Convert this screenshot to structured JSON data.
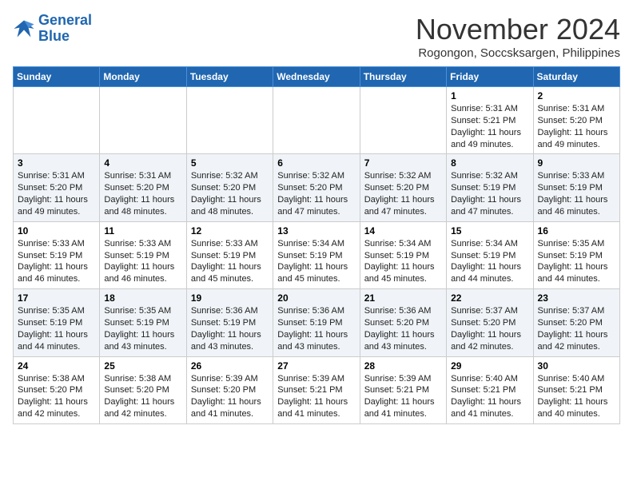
{
  "header": {
    "logo_line1": "General",
    "logo_line2": "Blue",
    "month": "November 2024",
    "location": "Rogongon, Soccsksargen, Philippines"
  },
  "weekdays": [
    "Sunday",
    "Monday",
    "Tuesday",
    "Wednesday",
    "Thursday",
    "Friday",
    "Saturday"
  ],
  "weeks": [
    [
      {
        "day": "",
        "info": ""
      },
      {
        "day": "",
        "info": ""
      },
      {
        "day": "",
        "info": ""
      },
      {
        "day": "",
        "info": ""
      },
      {
        "day": "",
        "info": ""
      },
      {
        "day": "1",
        "info": "Sunrise: 5:31 AM\nSunset: 5:21 PM\nDaylight: 11 hours\nand 49 minutes."
      },
      {
        "day": "2",
        "info": "Sunrise: 5:31 AM\nSunset: 5:20 PM\nDaylight: 11 hours\nand 49 minutes."
      }
    ],
    [
      {
        "day": "3",
        "info": "Sunrise: 5:31 AM\nSunset: 5:20 PM\nDaylight: 11 hours\nand 49 minutes."
      },
      {
        "day": "4",
        "info": "Sunrise: 5:31 AM\nSunset: 5:20 PM\nDaylight: 11 hours\nand 48 minutes."
      },
      {
        "day": "5",
        "info": "Sunrise: 5:32 AM\nSunset: 5:20 PM\nDaylight: 11 hours\nand 48 minutes."
      },
      {
        "day": "6",
        "info": "Sunrise: 5:32 AM\nSunset: 5:20 PM\nDaylight: 11 hours\nand 47 minutes."
      },
      {
        "day": "7",
        "info": "Sunrise: 5:32 AM\nSunset: 5:20 PM\nDaylight: 11 hours\nand 47 minutes."
      },
      {
        "day": "8",
        "info": "Sunrise: 5:32 AM\nSunset: 5:19 PM\nDaylight: 11 hours\nand 47 minutes."
      },
      {
        "day": "9",
        "info": "Sunrise: 5:33 AM\nSunset: 5:19 PM\nDaylight: 11 hours\nand 46 minutes."
      }
    ],
    [
      {
        "day": "10",
        "info": "Sunrise: 5:33 AM\nSunset: 5:19 PM\nDaylight: 11 hours\nand 46 minutes."
      },
      {
        "day": "11",
        "info": "Sunrise: 5:33 AM\nSunset: 5:19 PM\nDaylight: 11 hours\nand 46 minutes."
      },
      {
        "day": "12",
        "info": "Sunrise: 5:33 AM\nSunset: 5:19 PM\nDaylight: 11 hours\nand 45 minutes."
      },
      {
        "day": "13",
        "info": "Sunrise: 5:34 AM\nSunset: 5:19 PM\nDaylight: 11 hours\nand 45 minutes."
      },
      {
        "day": "14",
        "info": "Sunrise: 5:34 AM\nSunset: 5:19 PM\nDaylight: 11 hours\nand 45 minutes."
      },
      {
        "day": "15",
        "info": "Sunrise: 5:34 AM\nSunset: 5:19 PM\nDaylight: 11 hours\nand 44 minutes."
      },
      {
        "day": "16",
        "info": "Sunrise: 5:35 AM\nSunset: 5:19 PM\nDaylight: 11 hours\nand 44 minutes."
      }
    ],
    [
      {
        "day": "17",
        "info": "Sunrise: 5:35 AM\nSunset: 5:19 PM\nDaylight: 11 hours\nand 44 minutes."
      },
      {
        "day": "18",
        "info": "Sunrise: 5:35 AM\nSunset: 5:19 PM\nDaylight: 11 hours\nand 43 minutes."
      },
      {
        "day": "19",
        "info": "Sunrise: 5:36 AM\nSunset: 5:19 PM\nDaylight: 11 hours\nand 43 minutes."
      },
      {
        "day": "20",
        "info": "Sunrise: 5:36 AM\nSunset: 5:19 PM\nDaylight: 11 hours\nand 43 minutes."
      },
      {
        "day": "21",
        "info": "Sunrise: 5:36 AM\nSunset: 5:20 PM\nDaylight: 11 hours\nand 43 minutes."
      },
      {
        "day": "22",
        "info": "Sunrise: 5:37 AM\nSunset: 5:20 PM\nDaylight: 11 hours\nand 42 minutes."
      },
      {
        "day": "23",
        "info": "Sunrise: 5:37 AM\nSunset: 5:20 PM\nDaylight: 11 hours\nand 42 minutes."
      }
    ],
    [
      {
        "day": "24",
        "info": "Sunrise: 5:38 AM\nSunset: 5:20 PM\nDaylight: 11 hours\nand 42 minutes."
      },
      {
        "day": "25",
        "info": "Sunrise: 5:38 AM\nSunset: 5:20 PM\nDaylight: 11 hours\nand 42 minutes."
      },
      {
        "day": "26",
        "info": "Sunrise: 5:39 AM\nSunset: 5:20 PM\nDaylight: 11 hours\nand 41 minutes."
      },
      {
        "day": "27",
        "info": "Sunrise: 5:39 AM\nSunset: 5:21 PM\nDaylight: 11 hours\nand 41 minutes."
      },
      {
        "day": "28",
        "info": "Sunrise: 5:39 AM\nSunset: 5:21 PM\nDaylight: 11 hours\nand 41 minutes."
      },
      {
        "day": "29",
        "info": "Sunrise: 5:40 AM\nSunset: 5:21 PM\nDaylight: 11 hours\nand 41 minutes."
      },
      {
        "day": "30",
        "info": "Sunrise: 5:40 AM\nSunset: 5:21 PM\nDaylight: 11 hours\nand 40 minutes."
      }
    ]
  ]
}
